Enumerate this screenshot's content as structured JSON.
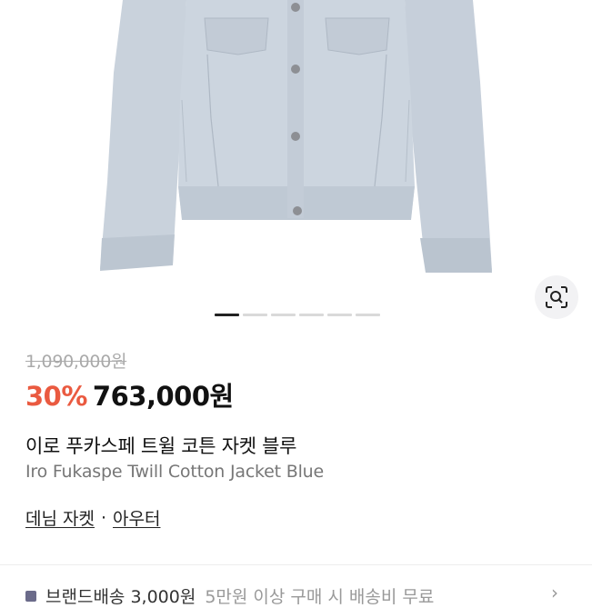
{
  "product": {
    "original_price": "1,090,000원",
    "discount": "30%",
    "price": "763,000원",
    "name_ko": "이로 푸카스페 트윌 코튼 자켓 블루",
    "name_en": "Iro Fukaspe Twill Cotton Jacket Blue"
  },
  "gallery": {
    "image_icon": "jacket-photo",
    "lens_icon": "image-search-icon",
    "dot_count": 6,
    "active_index": 0
  },
  "categories": {
    "first": "데님 자켓",
    "separator": "·",
    "second": "아우터"
  },
  "shipping": {
    "text": "브랜드배송 3,000원",
    "sub": "5만원 이상 구매 시 배송비 무료",
    "chevron_icon": "chevron-right-icon"
  },
  "colors": {
    "discount": "#ea5a40",
    "denim": "#c5ced8"
  }
}
